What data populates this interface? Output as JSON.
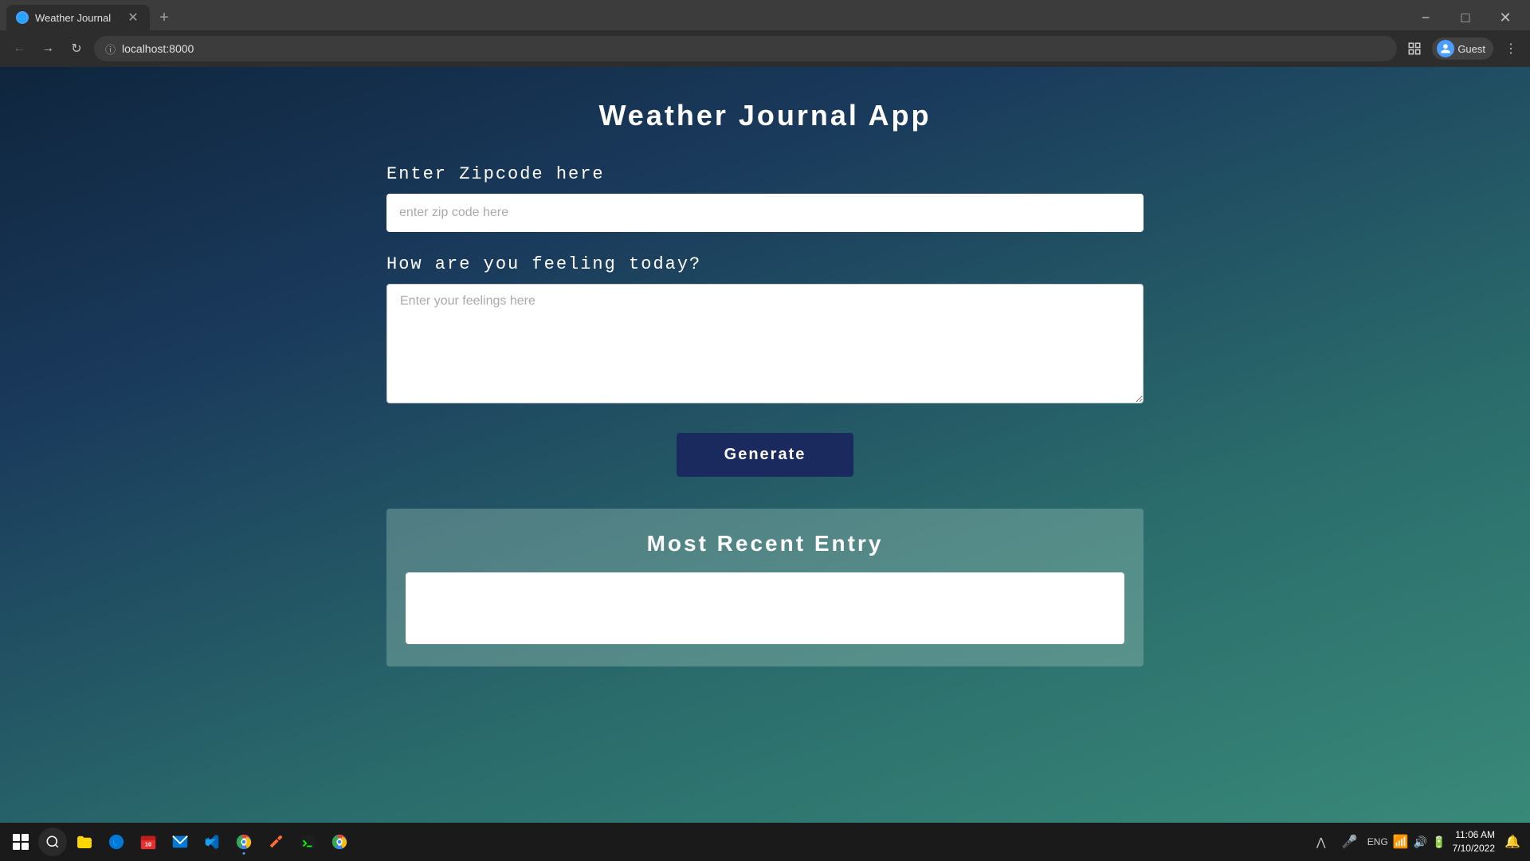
{
  "browser": {
    "tab_title": "Weather Journal",
    "tab_favicon": "🌐",
    "address_url": "localhost:8000",
    "address_icon": "🔒",
    "profile_name": "Guest",
    "new_tab_icon": "+",
    "close_icon": "✕",
    "minimize_icon": "−",
    "maximize_icon": "□",
    "back_icon": "←",
    "forward_icon": "→",
    "refresh_icon": "↺",
    "menu_icon": "⋮"
  },
  "app": {
    "title": "Weather Journal App",
    "zipcode_label": "Enter Zipcode here",
    "zipcode_placeholder": "enter zip code here",
    "feelings_label": "How are you feeling today?",
    "feelings_placeholder": "Enter your feelings here",
    "generate_button": "Generate",
    "recent_entry_title": "Most Recent Entry"
  },
  "taskbar": {
    "time": "11:06 AM",
    "date": "7/10/2022",
    "lang": "ENG",
    "search_icon": "🔍",
    "taskbar_icons": [
      {
        "name": "files-icon",
        "label": "File Explorer"
      },
      {
        "name": "edge-icon",
        "label": "Edge"
      },
      {
        "name": "calendar-icon",
        "label": "Calendar"
      },
      {
        "name": "mail-icon",
        "label": "Mail"
      },
      {
        "name": "vscode-icon",
        "label": "VS Code"
      },
      {
        "name": "chrome-icon",
        "label": "Chrome"
      },
      {
        "name": "tools-icon",
        "label": "Tools"
      },
      {
        "name": "terminal-icon",
        "label": "Terminal"
      },
      {
        "name": "chrome2-icon",
        "label": "Chrome 2"
      }
    ]
  }
}
